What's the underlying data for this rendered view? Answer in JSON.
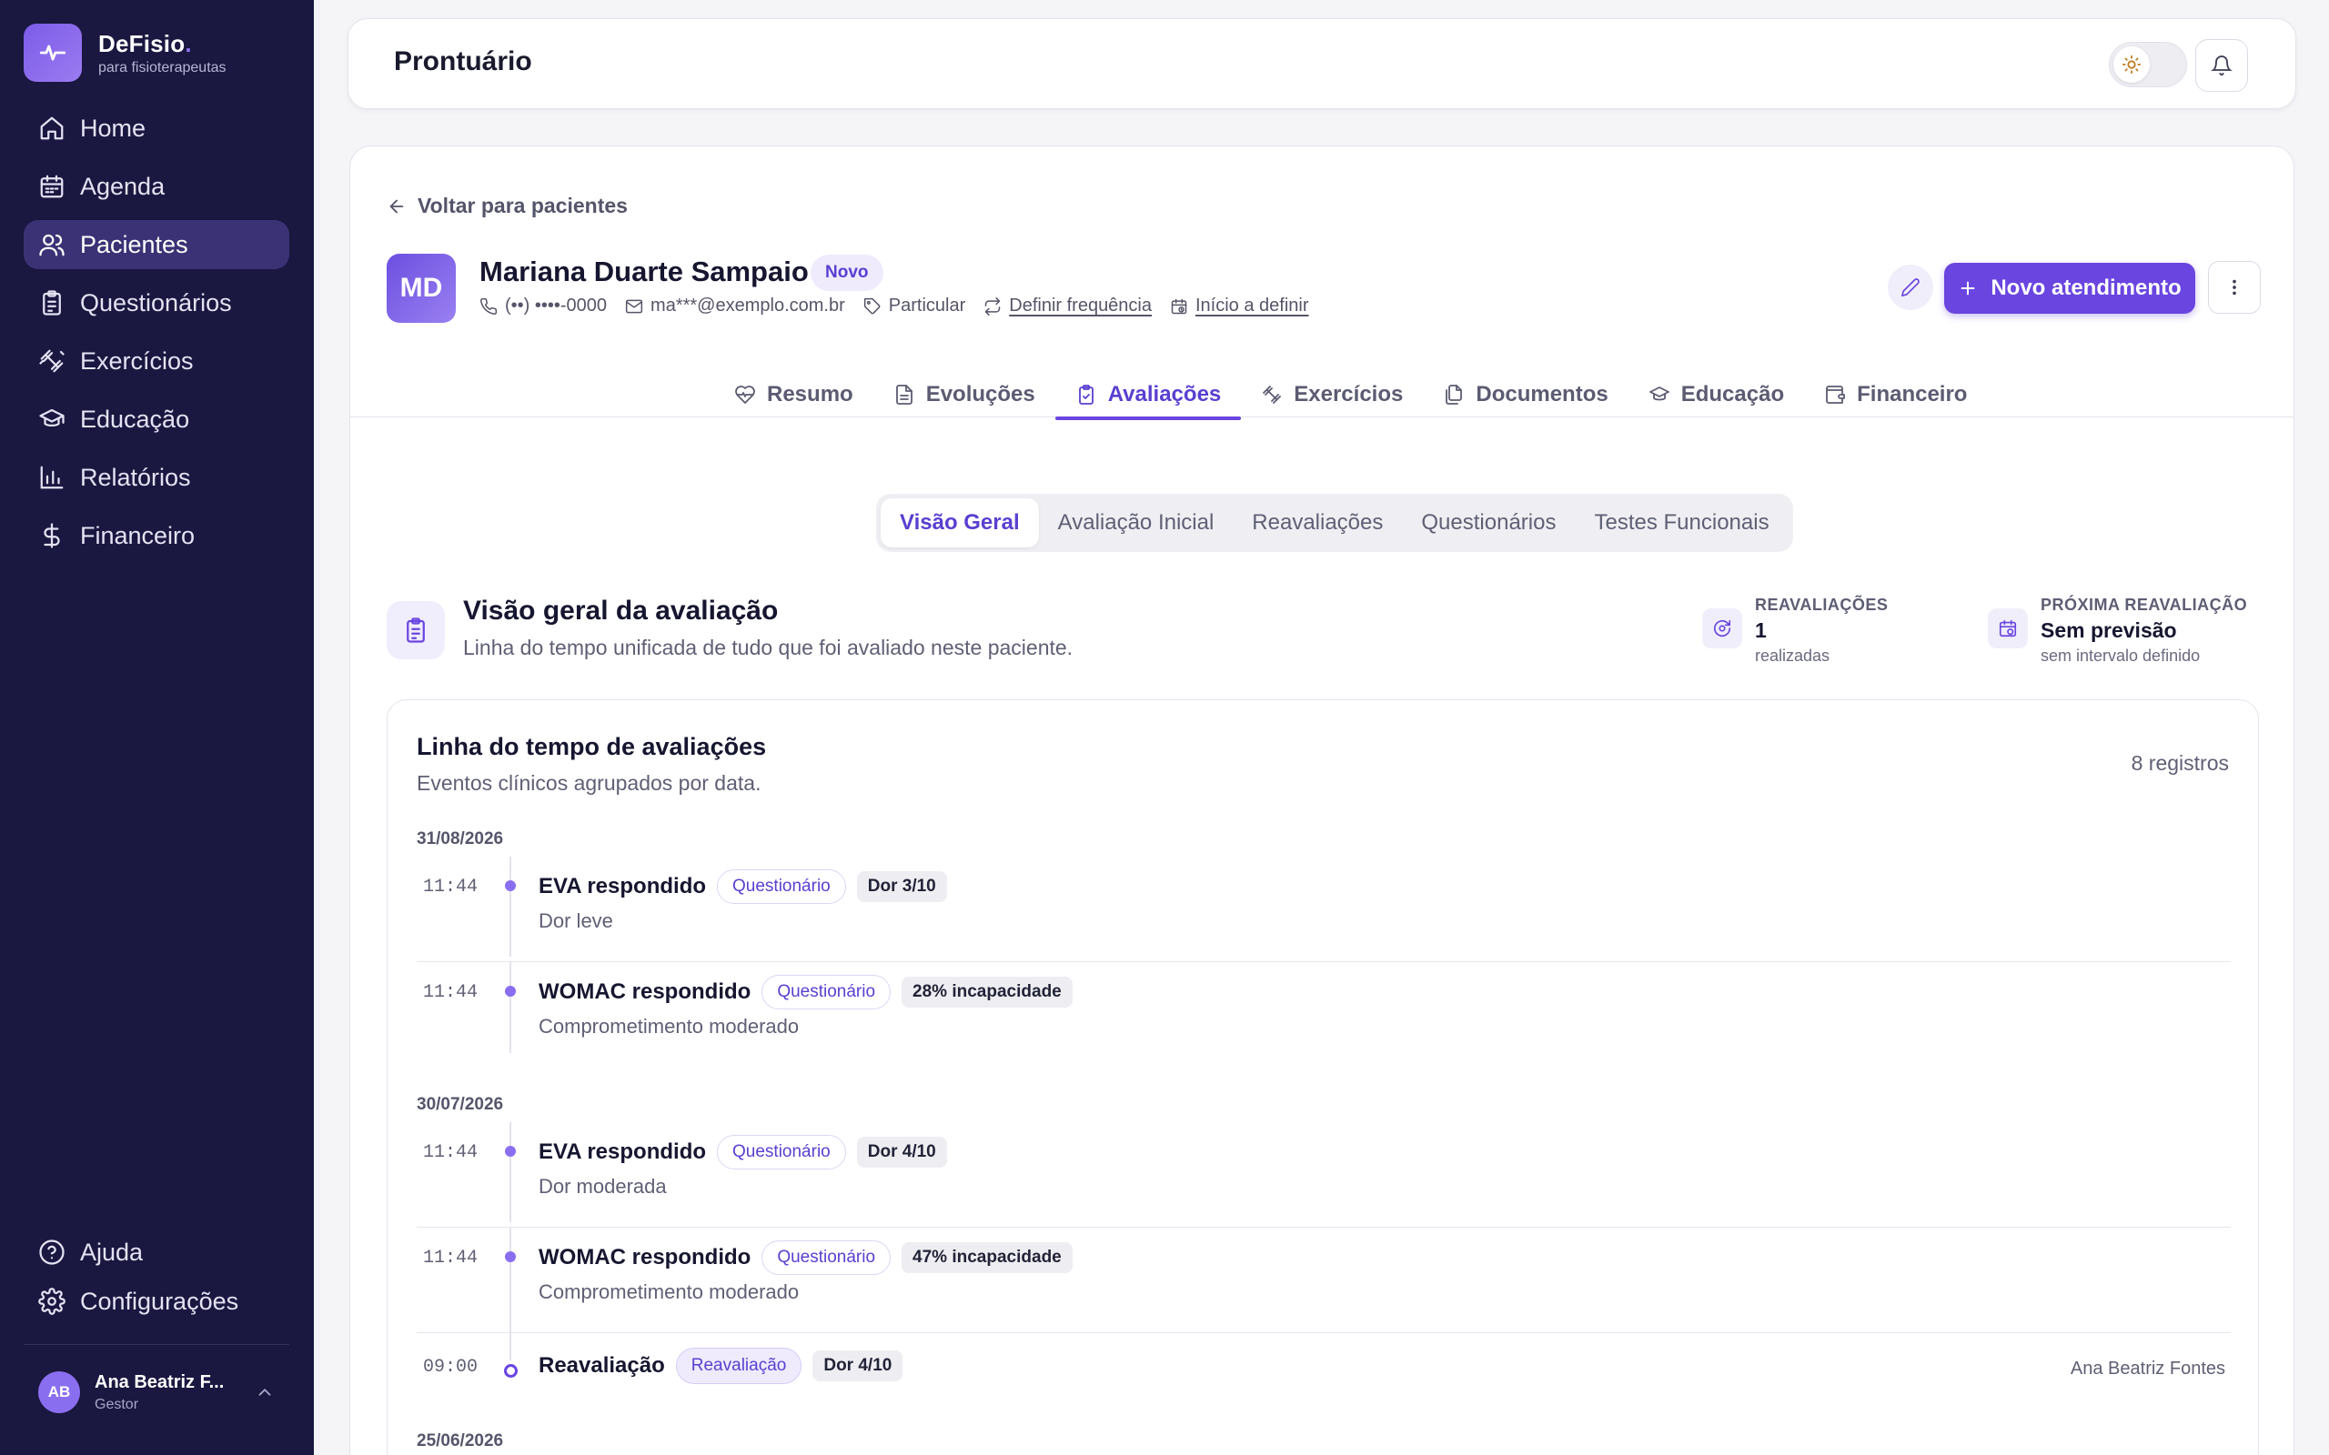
{
  "brand": {
    "name": "DeFisio",
    "dot": ".",
    "sub": "para fisioterapeutas"
  },
  "nav": {
    "items": [
      {
        "label": "Home",
        "icon": "home-icon"
      },
      {
        "label": "Agenda",
        "icon": "calendar-icon"
      },
      {
        "label": "Pacientes",
        "icon": "users-icon",
        "active": true
      },
      {
        "label": "Questionários",
        "icon": "clipboard-icon"
      },
      {
        "label": "Exercícios",
        "icon": "dumbbell-icon"
      },
      {
        "label": "Educação",
        "icon": "graduation-cap-icon"
      },
      {
        "label": "Relatórios",
        "icon": "bar-chart-icon"
      },
      {
        "label": "Financeiro",
        "icon": "dollar-icon"
      }
    ],
    "bottom": [
      {
        "label": "Ajuda",
        "icon": "help-circle-icon"
      },
      {
        "label": "Configurações",
        "icon": "gear-icon"
      }
    ]
  },
  "user": {
    "initials": "AB",
    "name": "Ana Beatriz F...",
    "role": "Gestor"
  },
  "topbar": {
    "title": "Prontuário"
  },
  "patient": {
    "back_label": "Voltar para pacientes",
    "initials": "MD",
    "name": "Mariana Duarte Sampaio",
    "badge": "Novo",
    "phone": "(••) ••••-0000",
    "email": "ma***@exemplo.com.br",
    "plan": "Particular",
    "frequency": "Definir frequência",
    "start": "Início a definir",
    "new_button": "Novo atendimento"
  },
  "tabs": [
    {
      "label": "Resumo",
      "icon": "heart-pulse-icon"
    },
    {
      "label": "Evoluções",
      "icon": "file-text-icon"
    },
    {
      "label": "Avaliações",
      "icon": "clipboard-check-icon",
      "active": true
    },
    {
      "label": "Exercícios",
      "icon": "dumbbell-icon"
    },
    {
      "label": "Documentos",
      "icon": "files-icon"
    },
    {
      "label": "Educação",
      "icon": "graduation-cap-icon"
    },
    {
      "label": "Financeiro",
      "icon": "wallet-icon"
    }
  ],
  "subtabs": [
    "Visão Geral",
    "Avaliação Inicial",
    "Reavaliações",
    "Questionários",
    "Testes Funcionais"
  ],
  "overview": {
    "title": "Visão geral da avaliação",
    "subtitle": "Linha do tempo unificada de tudo que foi avaliado neste paciente.",
    "stats": [
      {
        "label": "REAVALIAÇÕES",
        "value": "1",
        "hint": "realizadas",
        "icon": "refresh-icon"
      },
      {
        "label": "PRÓXIMA REAVALIAÇÃO",
        "value": "Sem previsão",
        "hint": "sem intervalo definido",
        "icon": "calendar-clock-icon"
      }
    ]
  },
  "timeline": {
    "title": "Linha do tempo de avaliações",
    "subtitle": "Eventos clínicos agrupados por data.",
    "count": "8 registros",
    "groups": [
      {
        "date": "31/08/2026",
        "entries": [
          {
            "time": "11:44",
            "title": "EVA respondido",
            "type": "Questionário",
            "value": "Dor 3/10",
            "desc": "Dor leve"
          },
          {
            "time": "11:44",
            "title": "WOMAC respondido",
            "type": "Questionário",
            "value": "28% incapacidade",
            "desc": "Comprometimento moderado"
          }
        ]
      },
      {
        "date": "30/07/2026",
        "entries": [
          {
            "time": "11:44",
            "title": "EVA respondido",
            "type": "Questionário",
            "value": "Dor 4/10",
            "desc": "Dor moderada"
          },
          {
            "time": "11:44",
            "title": "WOMAC respondido",
            "type": "Questionário",
            "value": "47% incapacidade",
            "desc": "Comprometimento moderado"
          },
          {
            "time": "09:00",
            "title": "Reavaliação",
            "type": "Reavaliação",
            "value": "Dor 4/10",
            "desc": "",
            "author": "Ana Beatriz Fontes"
          }
        ]
      },
      {
        "date": "25/06/2026",
        "entries": []
      }
    ]
  },
  "colors": {
    "accent": "#6a45e0",
    "sidebar": "#1a1740",
    "active_nav": "#3b3275"
  }
}
